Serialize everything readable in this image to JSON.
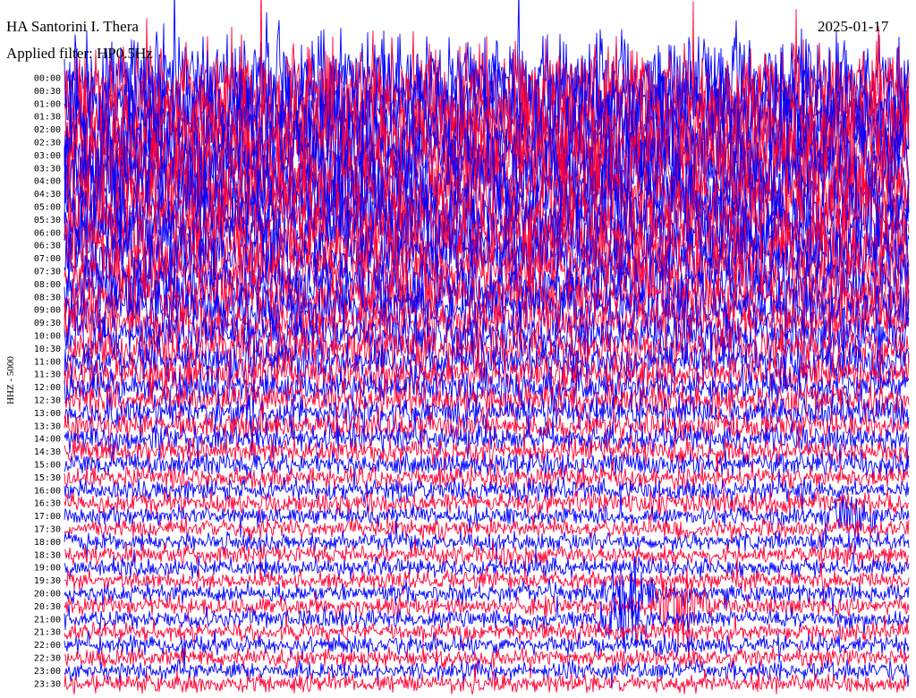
{
  "chart_data": {
    "type": "line",
    "title": "HA Santorini I. Thera",
    "subtitle": "Applied filter: HP0.5Hz",
    "date": "2025-01-17",
    "ylabel": "HHZ - 5000",
    "row_labels": [
      "00:00",
      "00:30",
      "01:00",
      "01:30",
      "02:00",
      "02:30",
      "03:00",
      "03:30",
      "04:00",
      "04:30",
      "05:00",
      "05:30",
      "06:00",
      "06:30",
      "07:00",
      "07:30",
      "08:00",
      "08:30",
      "09:00",
      "09:30",
      "10:00",
      "10:30",
      "11:00",
      "11:30",
      "12:00",
      "12:30",
      "13:00",
      "13:30",
      "14:00",
      "14:30",
      "15:00",
      "15:30",
      "16:00",
      "16:30",
      "17:00",
      "17:30",
      "18:00",
      "18:30",
      "19:00",
      "19:30",
      "20:00",
      "20:30",
      "21:00",
      "21:30",
      "22:00",
      "22:30",
      "23:00",
      "23:30"
    ],
    "row_colors": [
      "#0000ff",
      "#ff0033"
    ],
    "amplitude_per_row": [
      3.0,
      3.0,
      3.0,
      3.0,
      3.0,
      2.9,
      2.9,
      2.8,
      2.8,
      2.7,
      2.6,
      2.5,
      2.4,
      2.3,
      2.1,
      2.0,
      1.9,
      1.8,
      1.7,
      1.6,
      1.5,
      1.4,
      1.3,
      1.2,
      1.1,
      1.0,
      1.0,
      0.9,
      0.9,
      0.8,
      0.8,
      0.7,
      0.7,
      0.7,
      0.6,
      0.6,
      0.6,
      0.6,
      0.6,
      0.6,
      0.6,
      0.6,
      0.6,
      0.6,
      0.6,
      0.6,
      0.6,
      0.6
    ],
    "events": [
      {
        "row": 40,
        "minute": 20,
        "amplitude": 2.2
      },
      {
        "row": 41,
        "minute": 22,
        "amplitude": 2.8
      },
      {
        "row": 42,
        "minute": 20,
        "amplitude": 3.2
      },
      {
        "row": 34,
        "minute": 28,
        "amplitude": 1.6
      }
    ]
  }
}
